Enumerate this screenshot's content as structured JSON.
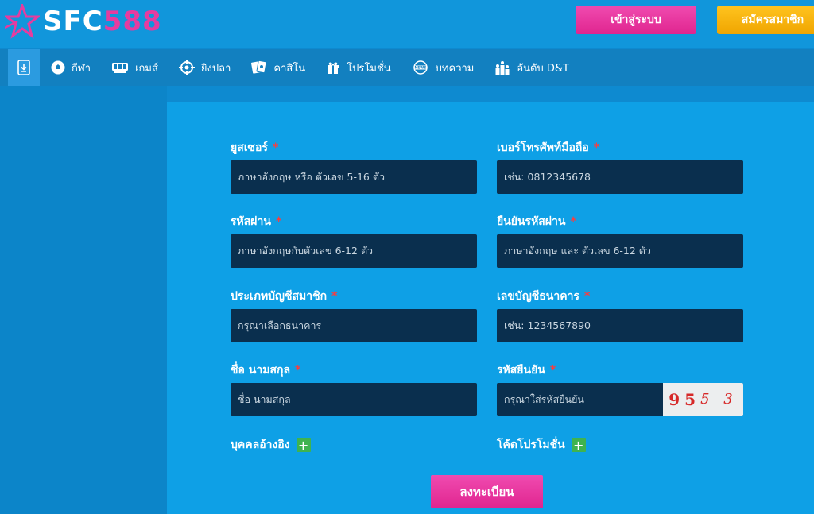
{
  "brand": {
    "logo_part1": "SFC",
    "logo_part2": "588"
  },
  "header": {
    "login_label": "เข้าสู่ระบบ",
    "register_label": "สมัครสมาชิก"
  },
  "nav": {
    "items": [
      {
        "label": "กีฬา",
        "icon": "soccer-ball-icon"
      },
      {
        "label": "เกมส์",
        "icon": "slot-machine-icon"
      },
      {
        "label": "ยิงปลา",
        "icon": "crosshair-icon"
      },
      {
        "label": "คาสิโน",
        "icon": "playing-cards-icon"
      },
      {
        "label": "โปรโมชั่น",
        "icon": "gift-icon"
      },
      {
        "label": "บทความ",
        "icon": "news-icon"
      },
      {
        "label": "อันดับ D&T",
        "icon": "ranking-icon"
      }
    ]
  },
  "form": {
    "username": {
      "label": "ยูสเซอร์",
      "required": "*",
      "placeholder": "ภาษาอังกฤษ หรือ ตัวเลข 5-16 ตัว"
    },
    "phone": {
      "label": "เบอร์โทรศัพท์มือถือ",
      "required": "*",
      "placeholder": "เช่น: 0812345678"
    },
    "password": {
      "label": "รหัสผ่าน",
      "required": "*",
      "placeholder": "ภาษาอังกฤษกับตัวเลข 6-12 ตัว"
    },
    "confirm_password": {
      "label": "ยืนยันรหัสผ่าน",
      "required": "*",
      "placeholder": "ภาษาอังกฤษ และ ตัวเลข 6-12 ตัว"
    },
    "account_type": {
      "label": "ประเภทบัญชีสมาชิก",
      "required": "*",
      "placeholder": "กรุณาเลือกธนาคาร"
    },
    "bank_account": {
      "label": "เลขบัญชีธนาคาร",
      "required": "*",
      "placeholder": "เช่น: 1234567890"
    },
    "full_name": {
      "label": "ชื่อ นามสกุล",
      "required": "*",
      "placeholder": "ชื่อ นามสกุล"
    },
    "captcha": {
      "label": "รหัสยืนยัน",
      "required": "*",
      "placeholder": "กรุณาใส่รหัสยืนยัน",
      "code_a": "95",
      "code_b": "5 3"
    },
    "referrer_label": "บุคคลอ้างอิง",
    "promo_code_label": "โค้ดโปรโมชั่น",
    "plus": "+",
    "submit_label": "ลงทะเบียน"
  },
  "colors": {
    "accent_pink": "#e53ca0",
    "accent_yellow": "#f5b211",
    "input_bg": "#0a2f4e",
    "required": "#ff3b3b"
  }
}
